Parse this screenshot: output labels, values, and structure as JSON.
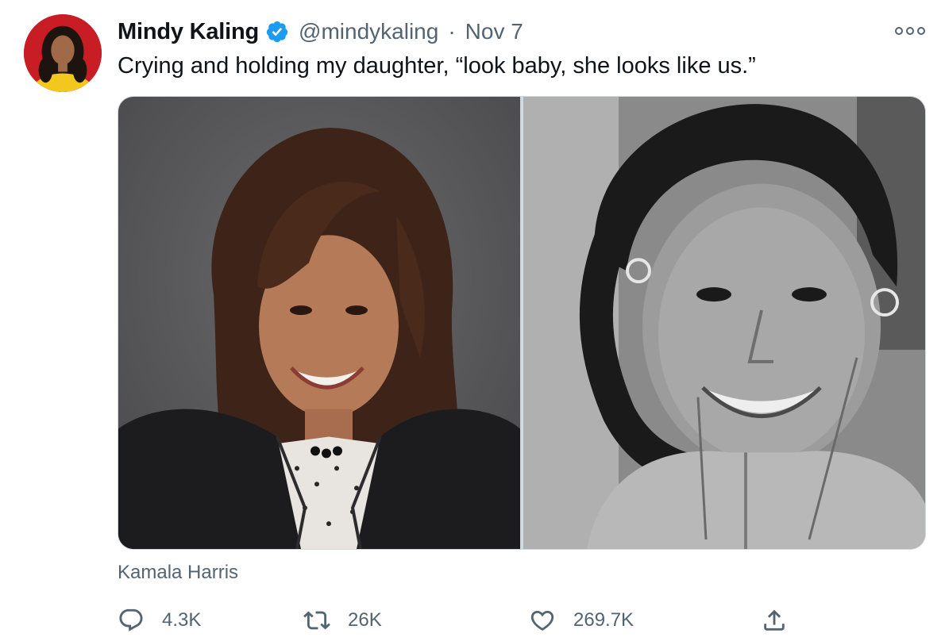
{
  "author": {
    "display_name": "Mindy Kaling",
    "handle": "@mindykaling",
    "separator": "·",
    "date": "Nov 7",
    "verified": true,
    "avatar_icon": "profile-photo",
    "verified_icon": "verified-badge-icon"
  },
  "tweet": {
    "text": "Crying and holding my daughter, “look baby, she looks like us.”"
  },
  "media": {
    "photos": [
      {
        "name": "portrait-color-photo"
      },
      {
        "name": "childhood-bw-photo"
      }
    ],
    "caption": "Kamala Harris"
  },
  "actions": {
    "reply": {
      "icon": "reply-icon",
      "count": "4.3K"
    },
    "retweet": {
      "icon": "retweet-icon",
      "count": "26K"
    },
    "like": {
      "icon": "heart-icon",
      "count": "269.7K"
    },
    "share": {
      "icon": "share-icon"
    }
  },
  "colors": {
    "text_primary": "#0f1419",
    "text_secondary": "#536471",
    "verified_blue": "#1d9bf0",
    "border": "#cfd9de"
  }
}
